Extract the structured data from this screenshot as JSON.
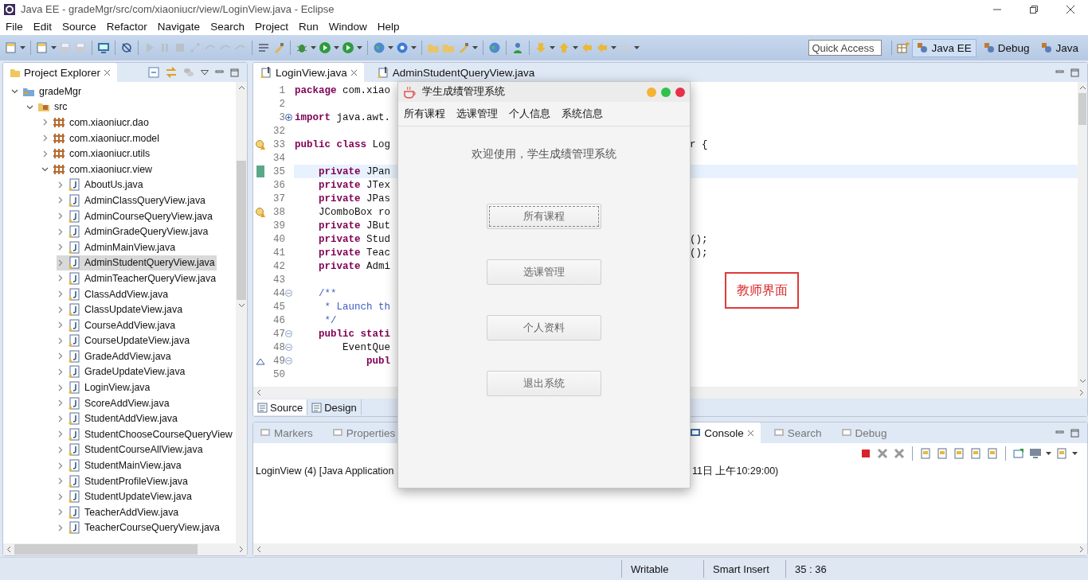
{
  "window": {
    "title": "Java EE - gradeMgr/src/com/xiaoniucr/view/LoginView.java - Eclipse"
  },
  "menu": [
    "File",
    "Edit",
    "Source",
    "Refactor",
    "Navigate",
    "Search",
    "Project",
    "Run",
    "Window",
    "Help"
  ],
  "quick_access": {
    "placeholder": "Quick Access"
  },
  "perspectives": [
    {
      "label": "Java EE",
      "selected": true
    },
    {
      "label": "Debug",
      "selected": false
    },
    {
      "label": "Java",
      "selected": false
    }
  ],
  "explorer": {
    "title": "Project Explorer",
    "tree": [
      {
        "label": "gradeMgr",
        "kind": "project",
        "expanded": true,
        "selected": false,
        "children": [
          {
            "label": "src",
            "kind": "folder",
            "expanded": true,
            "selected": false,
            "children": [
              {
                "label": "com.xiaoniucr.dao",
                "kind": "package",
                "expanded": false,
                "selected": false
              },
              {
                "label": "com.xiaoniucr.model",
                "kind": "package",
                "expanded": false,
                "selected": false
              },
              {
                "label": "com.xiaoniucr.utils",
                "kind": "package",
                "expanded": false,
                "selected": false
              },
              {
                "label": "com.xiaoniucr.view",
                "kind": "package",
                "expanded": true,
                "selected": false,
                "children": [
                  {
                    "label": "AboutUs.java",
                    "kind": "file",
                    "expanded": false,
                    "selected": false
                  },
                  {
                    "label": "AdminClassQueryView.java",
                    "kind": "file",
                    "expanded": false,
                    "selected": false
                  },
                  {
                    "label": "AdminCourseQueryView.java",
                    "kind": "file",
                    "expanded": false,
                    "selected": false
                  },
                  {
                    "label": "AdminGradeQueryView.java",
                    "kind": "file",
                    "expanded": false,
                    "selected": false
                  },
                  {
                    "label": "AdminMainView.java",
                    "kind": "file",
                    "expanded": false,
                    "selected": false
                  },
                  {
                    "label": "AdminStudentQueryView.java",
                    "kind": "file",
                    "expanded": false,
                    "selected": true
                  },
                  {
                    "label": "AdminTeacherQueryView.java",
                    "kind": "file",
                    "expanded": false,
                    "selected": false
                  },
                  {
                    "label": "ClassAddView.java",
                    "kind": "file",
                    "expanded": false,
                    "selected": false
                  },
                  {
                    "label": "ClassUpdateView.java",
                    "kind": "file",
                    "expanded": false,
                    "selected": false
                  },
                  {
                    "label": "CourseAddView.java",
                    "kind": "file",
                    "expanded": false,
                    "selected": false
                  },
                  {
                    "label": "CourseUpdateView.java",
                    "kind": "file",
                    "expanded": false,
                    "selected": false
                  },
                  {
                    "label": "GradeAddView.java",
                    "kind": "file",
                    "expanded": false,
                    "selected": false
                  },
                  {
                    "label": "GradeUpdateView.java",
                    "kind": "file",
                    "expanded": false,
                    "selected": false
                  },
                  {
                    "label": "LoginView.java",
                    "kind": "file",
                    "expanded": false,
                    "selected": false
                  },
                  {
                    "label": "ScoreAddView.java",
                    "kind": "file",
                    "expanded": false,
                    "selected": false
                  },
                  {
                    "label": "StudentAddView.java",
                    "kind": "file",
                    "expanded": false,
                    "selected": false
                  },
                  {
                    "label": "StudentChooseCourseQueryView",
                    "kind": "file",
                    "expanded": false,
                    "selected": false
                  },
                  {
                    "label": "StudentCourseAllView.java",
                    "kind": "file",
                    "expanded": false,
                    "selected": false
                  },
                  {
                    "label": "StudentMainView.java",
                    "kind": "file",
                    "expanded": false,
                    "selected": false
                  },
                  {
                    "label": "StudentProfileView.java",
                    "kind": "file",
                    "expanded": false,
                    "selected": false
                  },
                  {
                    "label": "StudentUpdateView.java",
                    "kind": "file",
                    "expanded": false,
                    "selected": false
                  },
                  {
                    "label": "TeacherAddView.java",
                    "kind": "file",
                    "expanded": false,
                    "selected": false
                  },
                  {
                    "label": "TeacherCourseQueryView.java",
                    "kind": "file",
                    "expanded": false,
                    "selected": false
                  }
                ]
              }
            ]
          }
        ]
      }
    ]
  },
  "editor": {
    "tabs": [
      {
        "label": "LoginView.java",
        "selected": true
      },
      {
        "label": "AdminStudentQueryView.java",
        "selected": false
      }
    ],
    "lines": [
      {
        "number": "1",
        "current": false,
        "segments": [
          {
            "kind": "keyword",
            "text": "package"
          },
          {
            "kind": "plain",
            "text": " com.xiao"
          }
        ]
      },
      {
        "number": "2",
        "current": false
      },
      {
        "number": "3",
        "current": false,
        "folded": true,
        "segments": [
          {
            "kind": "keyword",
            "text": "import"
          },
          {
            "kind": "plain",
            "text": " java.awt."
          }
        ]
      },
      {
        "number": "32",
        "current": false
      },
      {
        "number": "33",
        "current": false,
        "warning": true,
        "segments": [
          {
            "kind": "keyword",
            "text": "public class"
          },
          {
            "kind": "plain",
            "text": " Log"
          }
        ],
        "right": "r {"
      },
      {
        "number": "34",
        "current": false
      },
      {
        "number": "35",
        "current": true,
        "changed": true,
        "segments": [
          {
            "kind": "keyword",
            "text": "    private"
          },
          {
            "kind": "plain",
            "text": " JPan"
          }
        ]
      },
      {
        "number": "36",
        "current": false,
        "segments": [
          {
            "kind": "keyword",
            "text": "    private"
          },
          {
            "kind": "plain",
            "text": " JTex"
          }
        ]
      },
      {
        "number": "37",
        "current": false,
        "segments": [
          {
            "kind": "keyword",
            "text": "    private"
          },
          {
            "kind": "plain",
            "text": " JPas"
          }
        ]
      },
      {
        "number": "38",
        "current": false,
        "warning": true,
        "segments": [
          {
            "kind": "plain",
            "text": "    JComboBox ro"
          }
        ]
      },
      {
        "number": "39",
        "current": false,
        "segments": [
          {
            "kind": "keyword",
            "text": "    private"
          },
          {
            "kind": "plain",
            "text": " JBut"
          }
        ]
      },
      {
        "number": "40",
        "current": false,
        "segments": [
          {
            "kind": "keyword",
            "text": "    private"
          },
          {
            "kind": "plain",
            "text": " Stud"
          }
        ],
        "right": "();"
      },
      {
        "number": "41",
        "current": false,
        "segments": [
          {
            "kind": "keyword",
            "text": "    private"
          },
          {
            "kind": "plain",
            "text": " Teac"
          }
        ],
        "right": "();"
      },
      {
        "number": "42",
        "current": false,
        "segments": [
          {
            "kind": "keyword",
            "text": "    private"
          },
          {
            "kind": "plain",
            "text": " Admi"
          }
        ]
      },
      {
        "number": "43",
        "current": false
      },
      {
        "number": "44",
        "current": false,
        "folded": false,
        "segments": [
          {
            "kind": "comment",
            "text": "    /**"
          }
        ]
      },
      {
        "number": "45",
        "current": false,
        "segments": [
          {
            "kind": "comment",
            "text": "     * Launch th"
          }
        ]
      },
      {
        "number": "46",
        "current": false,
        "segments": [
          {
            "kind": "comment",
            "text": "     */"
          }
        ]
      },
      {
        "number": "47",
        "current": false,
        "folded": false,
        "segments": [
          {
            "kind": "keyword",
            "text": "    public stati"
          }
        ]
      },
      {
        "number": "48",
        "current": false,
        "folded": false,
        "segments": [
          {
            "kind": "plain",
            "text": "        EventQue"
          }
        ]
      },
      {
        "number": "49",
        "current": false,
        "folded": false,
        "overrides": true,
        "segments": [
          {
            "kind": "keyword",
            "text": "            publ"
          }
        ]
      },
      {
        "number": "50",
        "current": false
      }
    ],
    "mode_tabs": [
      {
        "label": "Source",
        "selected": true
      },
      {
        "label": "Design",
        "selected": false
      }
    ]
  },
  "bottom_panel": {
    "tabs": [
      {
        "label": "Markers",
        "selected": false
      },
      {
        "label": "Properties",
        "selected": false
      },
      {
        "label": "Console",
        "selected": true
      },
      {
        "label": "Search",
        "selected": false
      },
      {
        "label": "Debug",
        "selected": false
      }
    ],
    "console_left": "LoginView (4) [Java Application",
    "console_right": "11日 上午10:29:00)"
  },
  "status_bar": [
    "Writable",
    "Smart Insert",
    "35 : 36"
  ],
  "dialog": {
    "title": "学生成绩管理系统",
    "menu": [
      "所有课程",
      "选课管理",
      "个人信息",
      "系统信息"
    ],
    "welcome": "欢迎使用，学生成绩管理系统",
    "buttons": [
      {
        "label": "所有课程",
        "focused": true
      },
      {
        "label": "选课管理",
        "focused": false
      },
      {
        "label": "个人资料",
        "focused": false
      },
      {
        "label": "退出系统",
        "focused": false
      }
    ]
  },
  "annotation": "教师界面"
}
